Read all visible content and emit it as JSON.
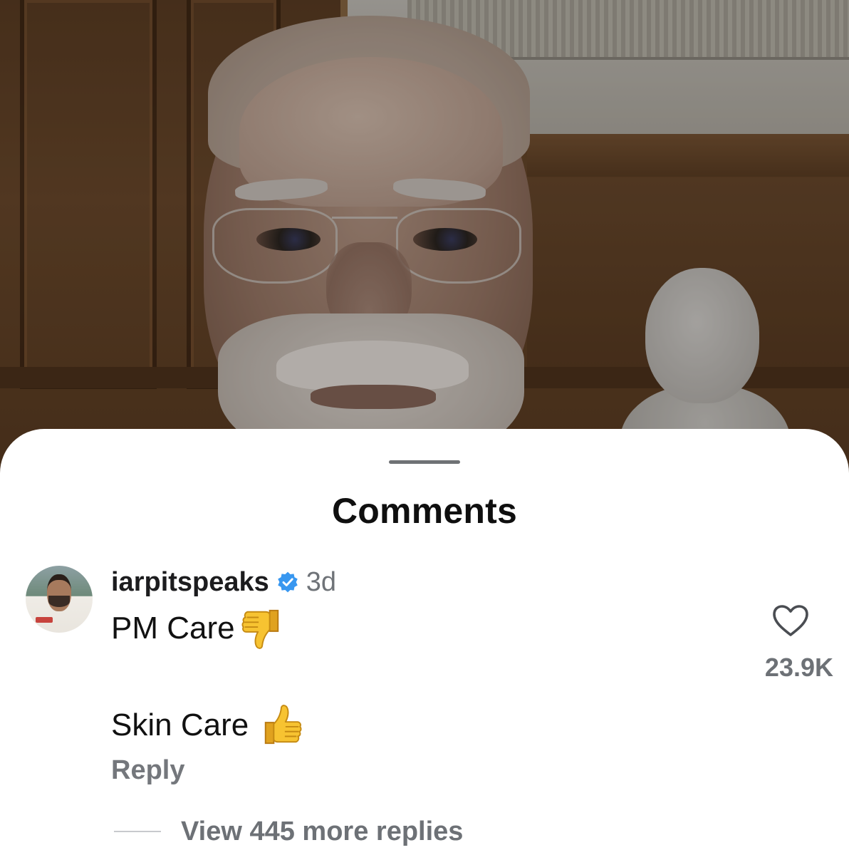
{
  "sheet": {
    "title": "Comments"
  },
  "comment": {
    "username": "iarpitspeaks",
    "verified_icon": "verified-badge-icon",
    "time": "3d",
    "line1_text": "PM Care",
    "line1_emoji": "thumbs-down-emoji",
    "line2_text": "Skin Care",
    "line2_emoji": "thumbs-up-emoji",
    "reply_label": "Reply",
    "like_icon": "heart-outline-icon",
    "like_count": "23.9K",
    "view_replies_label": "View 445 more replies"
  },
  "colors": {
    "sheet_background": "#ffffff",
    "verified_blue": "#3897f0",
    "secondary_text": "#6d7176",
    "primary_text": "#111111",
    "emoji_yellow": "#f5b72a"
  }
}
